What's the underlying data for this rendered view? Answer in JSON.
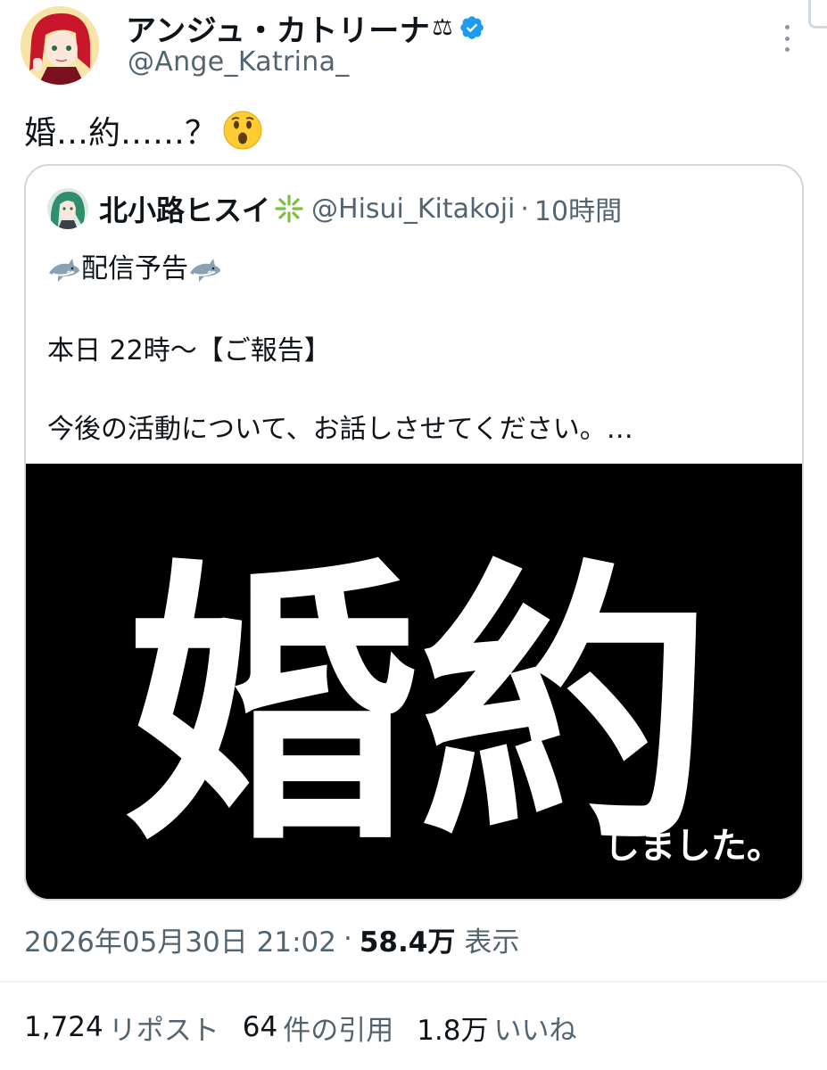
{
  "author": {
    "display_name": "アンジュ・カトリーナ",
    "name_emoji": "⚖",
    "handle": "@Ange_Katrina_"
  },
  "tweet": {
    "text": "婚…約……？"
  },
  "quote": {
    "display_name": "北小路ヒスイ",
    "handle": "@Hisui_Kitakoji",
    "separator": "·",
    "time": "10時間",
    "line1": "配信予告",
    "line2": "本日 22時〜【ご報告】",
    "line3": "今後の活動について、お話しさせてください。…",
    "image": {
      "big_text": "婚約",
      "small_text": "しました。"
    }
  },
  "meta": {
    "timestamp": "2026年05月30日 21:02",
    "separator": "·",
    "views_count": "58.4万",
    "views_label": "表示"
  },
  "stats": {
    "reposts_count": "1,724",
    "reposts_label": "リポスト",
    "quotes_count": "64",
    "quotes_label": "件の引用",
    "likes_count": "1.8万",
    "likes_label": "いいね"
  },
  "colors": {
    "text_primary": "#0f1419",
    "text_secondary": "#536471",
    "verified_blue": "#1d9bf0",
    "border": "#cfd9de"
  },
  "icons": [
    "verified-badge-icon",
    "more-options-icon",
    "astonished-face-emoji",
    "shark-emoji",
    "sparkle-emoji",
    "scales-emoji"
  ]
}
